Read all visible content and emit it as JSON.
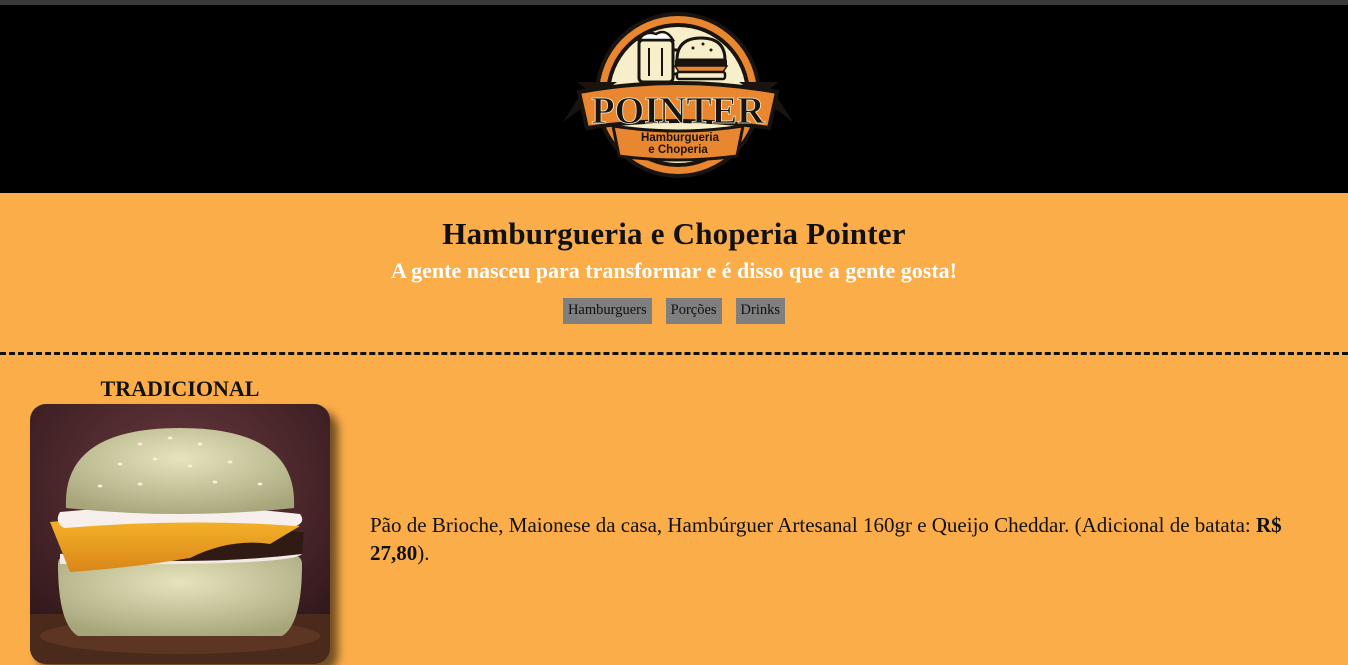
{
  "logo": {
    "brand": "POINTER",
    "subtitle_line1": "Hamburgueria",
    "subtitle_line2": "e Choperia"
  },
  "hero": {
    "title": "Hamburgueria e Choperia Pointer",
    "tagline": "A gente nasceu para transformar e é disso que a gente gosta!"
  },
  "nav": {
    "items": [
      {
        "label": "Hamburguers"
      },
      {
        "label": "Porções"
      },
      {
        "label": "Drinks"
      }
    ]
  },
  "menu_item": {
    "title": "TRADICIONAL",
    "description_prefix": "Pão de Brioche, Maionese da casa, Hambúrguer Artesanal 160gr e Queijo Cheddar. (Adicional de batata: ",
    "price": "R$ 27,80",
    "description_suffix": ")."
  },
  "colors": {
    "background": "#fbad4a",
    "header": "#000000",
    "nav_button": "#7f7f7f",
    "logo_orange": "#e8872f"
  }
}
